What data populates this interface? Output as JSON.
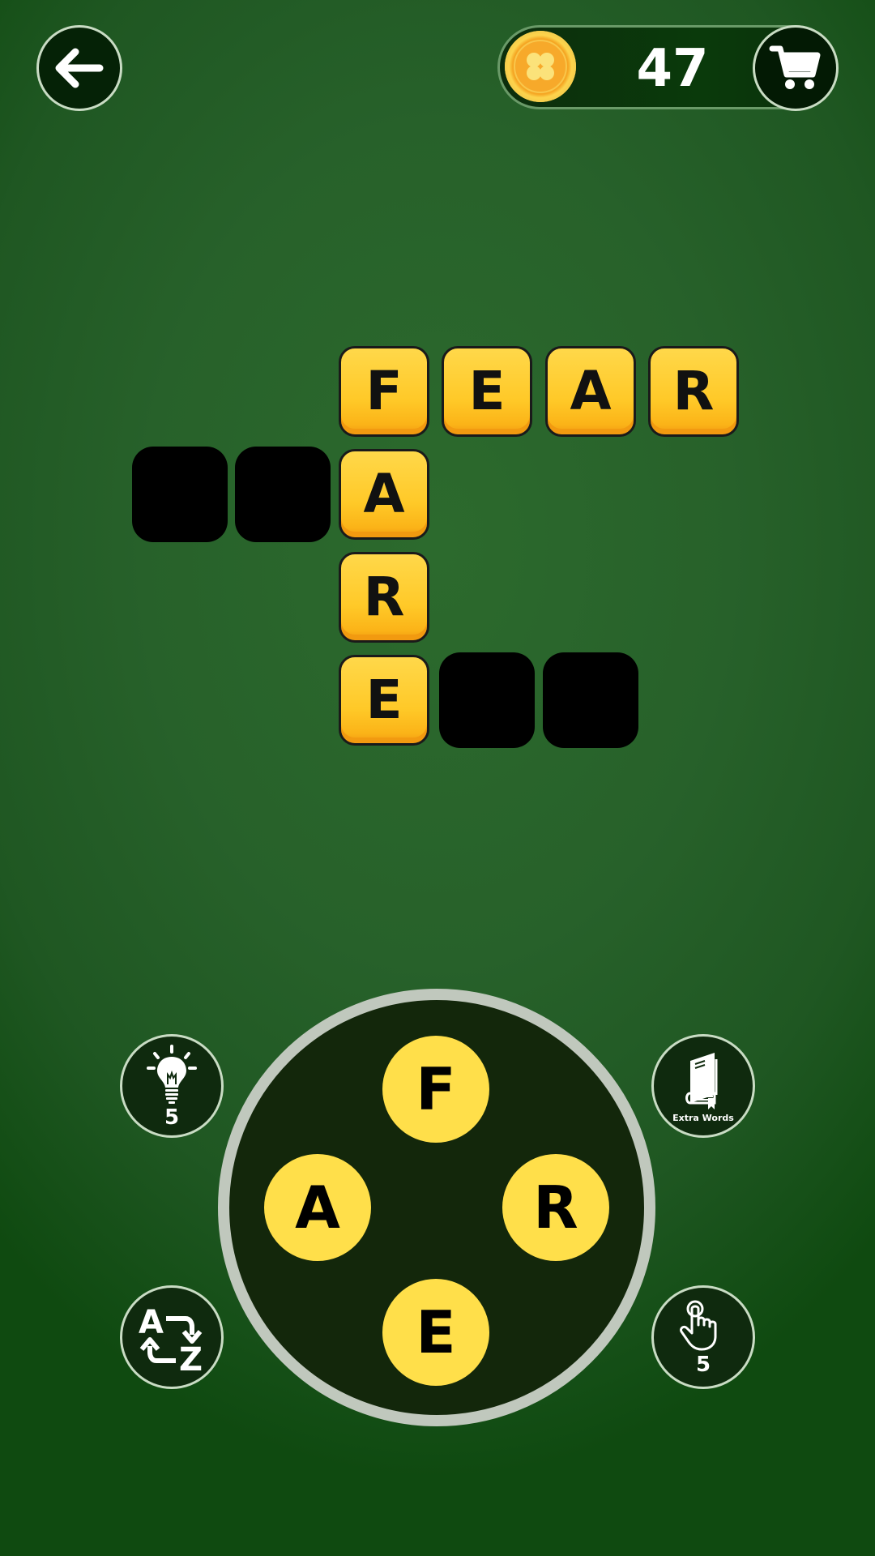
{
  "header": {
    "back_icon": "arrow-left-icon",
    "coins": {
      "icon": "clover-coin-icon",
      "count": "47",
      "coin_color": "#f5a623"
    },
    "shop_icon": "shopping-cart-icon"
  },
  "board": {
    "words": [
      {
        "direction": "across",
        "letters": [
          "F",
          "E",
          "A",
          "R"
        ],
        "revealed": true
      },
      {
        "direction": "down",
        "letters": [
          "F",
          "A",
          "R",
          "E"
        ],
        "revealed": true
      },
      {
        "direction": "across",
        "letters": [
          "",
          "",
          "A"
        ],
        "revealed": false
      },
      {
        "direction": "across",
        "letters": [
          "E",
          "",
          ""
        ],
        "revealed": false
      }
    ],
    "tiles": [
      {
        "row": 0,
        "col": 2,
        "letter": "F",
        "state": "filled"
      },
      {
        "row": 0,
        "col": 3,
        "letter": "E",
        "state": "filled"
      },
      {
        "row": 0,
        "col": 4,
        "letter": "A",
        "state": "filled"
      },
      {
        "row": 0,
        "col": 5,
        "letter": "R",
        "state": "filled"
      },
      {
        "row": 1,
        "col": 0,
        "letter": "",
        "state": "empty"
      },
      {
        "row": 1,
        "col": 1,
        "letter": "",
        "state": "empty"
      },
      {
        "row": 1,
        "col": 2,
        "letter": "A",
        "state": "filled"
      },
      {
        "row": 2,
        "col": 2,
        "letter": "R",
        "state": "filled"
      },
      {
        "row": 3,
        "col": 2,
        "letter": "E",
        "state": "filled"
      },
      {
        "row": 3,
        "col": 3,
        "letter": "",
        "state": "empty"
      },
      {
        "row": 3,
        "col": 4,
        "letter": "",
        "state": "empty"
      }
    ],
    "tile_color": "#ffc928",
    "empty_color": "#000000"
  },
  "wheel": {
    "letters": [
      {
        "position": "top",
        "letter": "F"
      },
      {
        "position": "left",
        "letter": "A"
      },
      {
        "position": "right",
        "letter": "R"
      },
      {
        "position": "bottom",
        "letter": "E"
      }
    ],
    "letter_color": "#ffdf4a",
    "background_color": "#13270b"
  },
  "tools": {
    "hint": {
      "icon": "lightbulb-icon",
      "count": "5"
    },
    "extra_words": {
      "icon": "book-icon",
      "label": "Extra Words"
    },
    "shuffle": {
      "icon": "shuffle-az-icon"
    },
    "finger_reveal": {
      "icon": "finger-tap-icon",
      "count": "5"
    }
  }
}
